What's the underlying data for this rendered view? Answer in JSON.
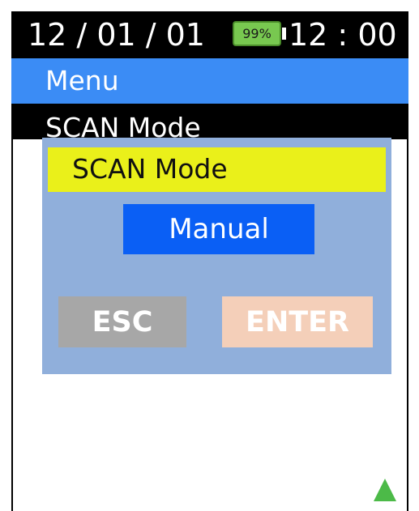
{
  "status": {
    "date": "12 / 01 / 01",
    "battery_label": "99%",
    "time": "12 : 00"
  },
  "menu": {
    "title": "Menu"
  },
  "screen": {
    "title": "SCAN Mode"
  },
  "dialog": {
    "title": "SCAN Mode",
    "value": "Manual",
    "esc_label": "ESC",
    "enter_label": "ENTER"
  },
  "icons": {
    "scroll_indicator": "triangle-up-icon"
  },
  "colors": {
    "menu_bar": "#3b8cf5",
    "dialog_bg": "#90afdb",
    "dialog_header": "#eaf01a",
    "value_box": "#0a5ff5",
    "esc_button": "#a7a7a7",
    "enter_button": "#f4cfb9",
    "battery": "#78c850",
    "scroll_arrow": "#4cba48"
  }
}
